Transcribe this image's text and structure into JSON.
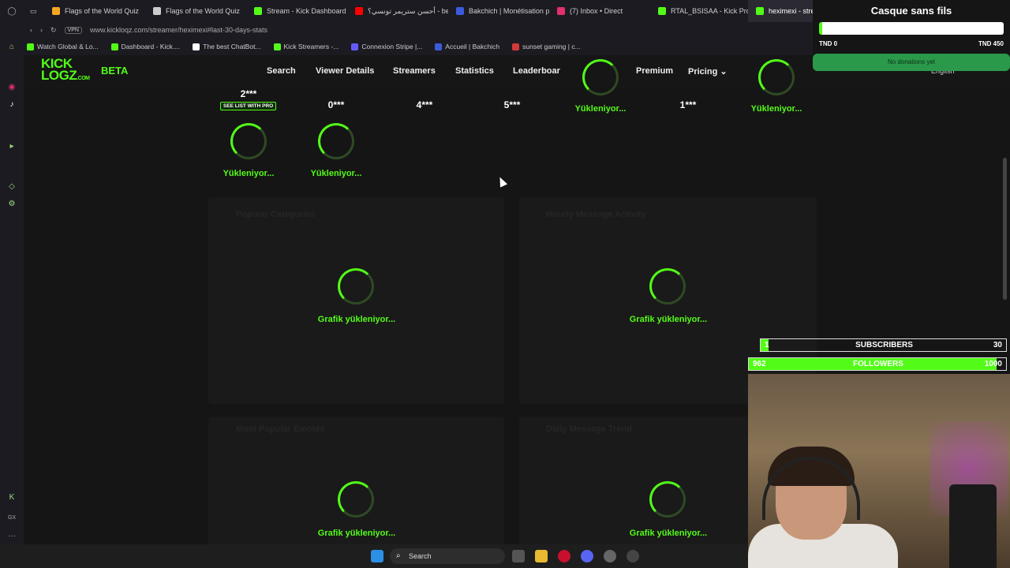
{
  "browser": {
    "tabs": [
      {
        "title": "Flags of the World Quiz",
        "color": "#f5a623"
      },
      {
        "title": "Flags of the World Quiz",
        "color": "#cccccc"
      },
      {
        "title": "Stream - Kick Dashboard",
        "color": "#53fc18"
      },
      {
        "title": "أحسن ستريمر تونسي؟ - be",
        "color": "#ff0000"
      },
      {
        "title": "Bakchich | Monétisation p",
        "color": "#3b5bdb"
      },
      {
        "title": "(7) Inbox • Direct",
        "color": "#e1306c"
      },
      {
        "title": "RTAL_BSISAA - Kick Prof",
        "color": "#53fc18"
      },
      {
        "title": "heximexi - strea",
        "color": "#53fc18"
      }
    ],
    "url": "www.kickloqz.com/streamer/heximexi#last-30-days-stats",
    "vpn_label": "VPN",
    "bookmarks": [
      {
        "label": "Watch Global & Lo...",
        "color": "#53fc18"
      },
      {
        "label": "Dashboard - Kick....",
        "color": "#53fc18"
      },
      {
        "label": "The best ChatBot...",
        "color": "#ffffff"
      },
      {
        "label": "Kick Streamers -...",
        "color": "#53fc18"
      },
      {
        "label": "Connexion Stripe |...",
        "color": "#635bff"
      },
      {
        "label": "Accueil | Bakchich",
        "color": "#3b5bdb"
      },
      {
        "label": "sunset gaming | c...",
        "color": "#d13a3a"
      }
    ]
  },
  "site": {
    "logo_top": "KICK",
    "logo_bottom": "LOGZ",
    "logo_suffix": ".COM",
    "beta": "BETA",
    "nav": [
      "Search",
      "Viewer Details",
      "Streamers",
      "Statistics",
      "Leaderboar",
      "Premium",
      "Pricing ⌄"
    ],
    "language": "English"
  },
  "ranks": [
    {
      "value": "2***",
      "badge": "SEE LIST WITH PRO"
    },
    {
      "value": "0***"
    },
    {
      "value": "4***"
    },
    {
      "value": "5***"
    },
    {
      "value": "1***"
    }
  ],
  "loading_text": "Yükleniyor...",
  "chart_loading": "Grafik yükleniyor...",
  "ghost_labels": {
    "popular_categories": "Popular Categories",
    "hourly_activity": "Hourly Message Activity",
    "popular_emotes": "Most Popular Emotes",
    "daily_trend": "Daily Message Trend"
  },
  "overlays": {
    "donation": {
      "title": "Casque sans fils",
      "min": "TND 0",
      "max": "TND 450",
      "note": "No donations yet",
      "progress": 0.0
    },
    "subscribers": {
      "current": "1",
      "label": "SUBSCRIBERS",
      "goal": "30",
      "progress": 0.033
    },
    "followers": {
      "current": "962",
      "label": "FOLLOWERS",
      "goal": "1000",
      "progress": 0.962
    }
  },
  "taskbar": {
    "search_placeholder": "Search"
  }
}
